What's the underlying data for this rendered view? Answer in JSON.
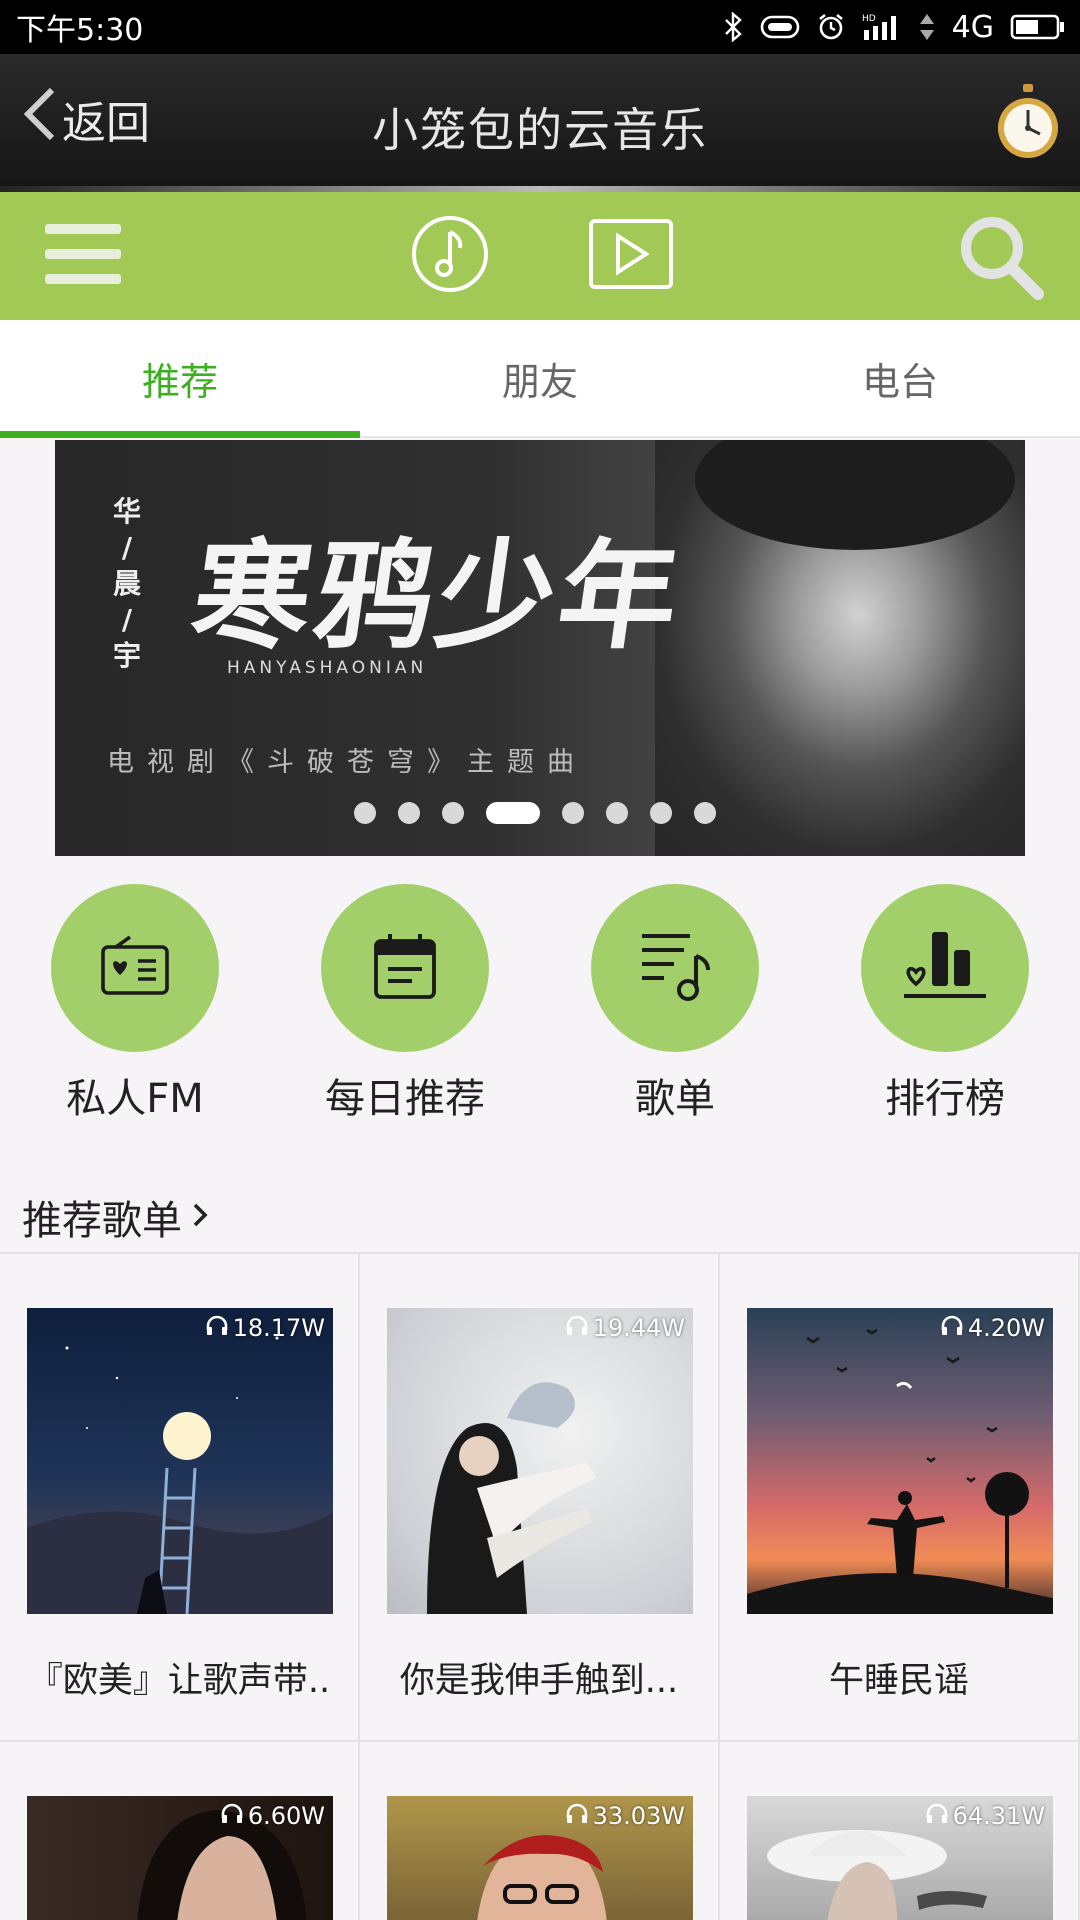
{
  "status": {
    "time": "下午5:30",
    "network": "4G"
  },
  "header": {
    "back_label": "返回",
    "title": "小笼包的云音乐"
  },
  "tabs": [
    {
      "label": "推荐"
    },
    {
      "label": "朋友"
    },
    {
      "label": "电台"
    }
  ],
  "banner": {
    "artist": [
      "华",
      "/",
      "晨",
      "/",
      "宇"
    ],
    "title": "寒鸦少年",
    "pinyin": "HANYASHAONIAN",
    "subtitle": "电视剧《斗破苍穹》主题曲",
    "dot_count": 8,
    "active_dot": 4
  },
  "quick_nav": [
    {
      "label": "私人FM",
      "icon": "radio-icon"
    },
    {
      "label": "每日推荐",
      "icon": "calendar-icon"
    },
    {
      "label": "歌单",
      "icon": "playlist-icon"
    },
    {
      "label": "排行榜",
      "icon": "chart-icon"
    }
  ],
  "section": {
    "title": "推荐歌单"
  },
  "playlists": [
    {
      "title": "『欧美』让歌声带..",
      "plays": "18.17W"
    },
    {
      "title": "你是我伸手触到...",
      "plays": "19.44W"
    },
    {
      "title": "午睡民谣",
      "plays": "4.20W"
    },
    {
      "title": "",
      "plays": "6.60W"
    },
    {
      "title": "",
      "plays": "33.03W"
    },
    {
      "title": "",
      "plays": "64.31W"
    }
  ],
  "colors": {
    "accent": "#3db022",
    "toolbar": "#a2c956",
    "circle": "#a2cf6a"
  }
}
